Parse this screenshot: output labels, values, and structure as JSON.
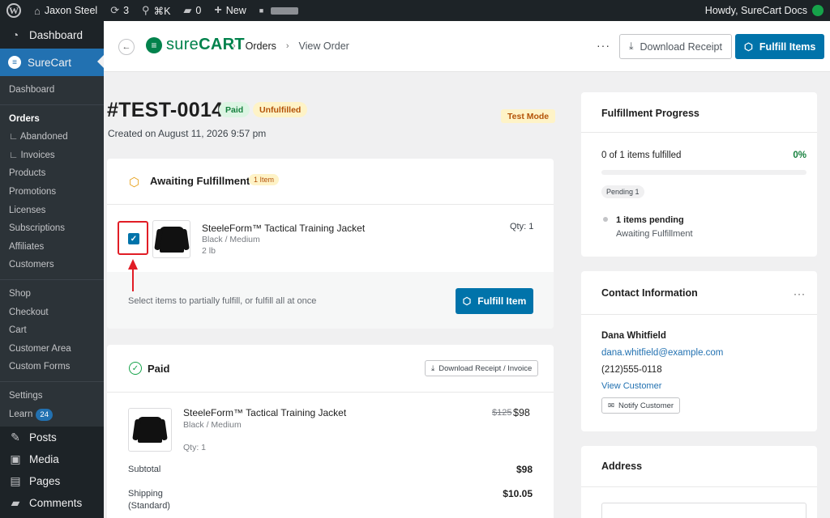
{
  "adminbar": {
    "site_name": "Jaxon Steel",
    "updates_count": "3",
    "search_shortcut": "⌘K",
    "comments_count": "0",
    "new_label": "New",
    "howdy": "Howdy, SureCart Docs"
  },
  "sidebar": {
    "dashboard": "Dashboard",
    "surecart": "SureCart",
    "sub_items": [
      {
        "label": "Dashboard"
      },
      {
        "label": "Orders"
      },
      {
        "label": "∟ Abandoned"
      },
      {
        "label": "∟ Invoices"
      },
      {
        "label": "Products"
      },
      {
        "label": "Promotions"
      },
      {
        "label": "Licenses"
      },
      {
        "label": "Subscriptions"
      },
      {
        "label": "Affiliates"
      },
      {
        "label": "Customers"
      },
      {
        "label": "Shop"
      },
      {
        "label": "Checkout"
      },
      {
        "label": "Cart"
      },
      {
        "label": "Customer Area"
      },
      {
        "label": "Custom Forms"
      },
      {
        "label": "Settings"
      },
      {
        "label": "Learn"
      }
    ],
    "learn_badge": "24",
    "posts": "Posts",
    "media": "Media",
    "pages": "Pages",
    "comments": "Comments"
  },
  "header": {
    "logo_sure": "sure",
    "logo_cart": "CART",
    "crumb_orders": "Orders",
    "crumb_view": "View Order",
    "more": "···",
    "download_receipt": "Download Receipt",
    "fulfill_items": "Fulfill Items"
  },
  "order": {
    "number": "#TEST-0014",
    "paid_badge": "Paid",
    "unfulfilled_badge": "Unfulfilled",
    "test_mode": "Test Mode",
    "created": "Created on August 11, 2026 9:57 pm"
  },
  "awaiting": {
    "title": "Awaiting Fulfillment",
    "badge": "1 Item",
    "item_name": "SteeleForm™ Tactical Training Jacket",
    "item_variant": "Black / Medium",
    "item_weight": "2 lb",
    "qty": "Qty: 1",
    "hint": "Select items to partially fulfill, or fulfill all at once",
    "fulfill_button": "Fulfill Item",
    "checkbox_checked": true
  },
  "paid": {
    "title": "Paid",
    "download_button": "Download Receipt / Invoice",
    "item_name": "SteeleForm™ Tactical Training Jacket",
    "item_variant": "Black / Medium",
    "item_qty": "Qty: 1",
    "price_original": "$125",
    "price_current": "$98",
    "subtotal_label": "Subtotal",
    "subtotal_value": "$98",
    "shipping_label": "Shipping",
    "shipping_method": "(Standard)",
    "shipping_value": "$10.05"
  },
  "progress": {
    "title": "Fulfillment Progress",
    "status_text": "0 of 1 items fulfilled",
    "percent_label": "0%",
    "percent": 0,
    "pending_pill": "Pending 1",
    "pending_line": "1 items pending",
    "pending_sub": "Awaiting Fulfillment"
  },
  "contact": {
    "title": "Contact Information",
    "more": "···",
    "name": "Dana Whitfield",
    "email": "dana.whitfield@example.com",
    "phone": "(212)555-0118",
    "view_customer": "View Customer",
    "notify": "Notify Customer"
  },
  "address": {
    "title": "Address"
  },
  "colors": {
    "primary": "#0073aa",
    "brand_green": "#01824c",
    "paid_green": "#15803d",
    "warning": "#b45309",
    "highlight_red": "#e11d26"
  }
}
